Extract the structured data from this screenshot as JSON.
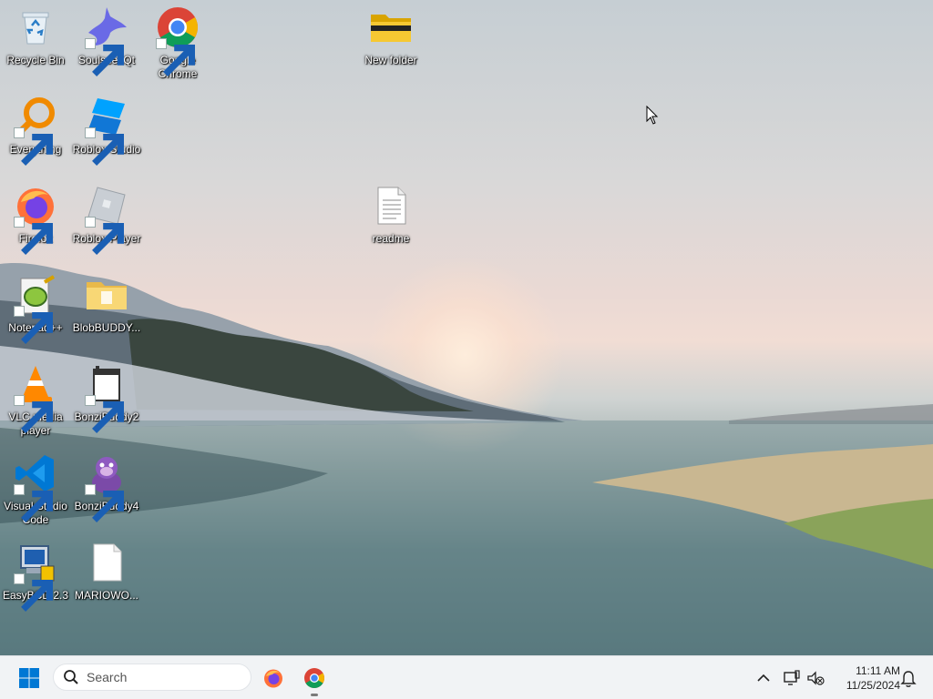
{
  "desktop": {
    "icons": [
      {
        "label": "Recycle Bin",
        "icon": "recycle-bin-icon"
      },
      {
        "label": "SoulseekQt",
        "icon": "soulseek-icon"
      },
      {
        "label": "Google Chrome",
        "icon": "chrome-icon"
      },
      {
        "label": "New folder",
        "icon": "folder-icon"
      },
      {
        "label": "Everything",
        "icon": "everything-search-icon"
      },
      {
        "label": "Roblox Studio",
        "icon": "roblox-studio-icon"
      },
      {
        "label": "Firefox",
        "icon": "firefox-icon"
      },
      {
        "label": "Roblox Player",
        "icon": "roblox-player-icon"
      },
      {
        "label": "readme",
        "icon": "text-file-icon"
      },
      {
        "label": "Notepad++",
        "icon": "notepad-plus-plus-icon"
      },
      {
        "label": "BlobBUDDY...",
        "icon": "folder-icon"
      },
      {
        "label": "VLC media player",
        "icon": "vlc-icon"
      },
      {
        "label": "BonziBuddy2",
        "icon": "app-window-icon"
      },
      {
        "label": "Visual Studio Code",
        "icon": "vscode-icon"
      },
      {
        "label": "BonziBuddy4",
        "icon": "bonzi-gorilla-icon"
      },
      {
        "label": "EasyBCD 2.3",
        "icon": "easybcd-icon"
      },
      {
        "label": "MARIOWO...",
        "icon": "blank-file-icon"
      }
    ]
  },
  "taskbar": {
    "search_placeholder": "Search",
    "pinned": [
      {
        "name": "Firefox",
        "icon": "firefox-icon"
      },
      {
        "name": "Google Chrome",
        "icon": "chrome-icon",
        "running": true
      }
    ],
    "clock": {
      "time": "11:11 AM",
      "date": "11/25/2024"
    }
  },
  "colors": {
    "taskbar_bg": "#f1f3f5",
    "windows_blue": "#0078d4"
  }
}
